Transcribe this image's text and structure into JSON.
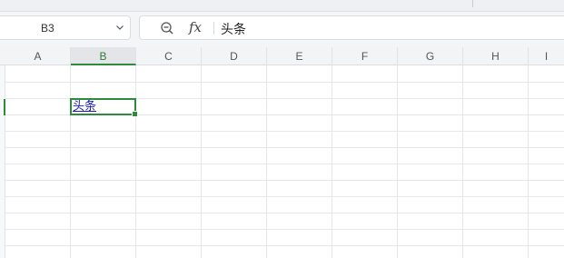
{
  "name_box": {
    "value": "B3"
  },
  "formula_bar": {
    "fx_label": "fx",
    "value": "头条"
  },
  "columns": [
    "A",
    "B",
    "C",
    "D",
    "E",
    "F",
    "G",
    "H",
    "I"
  ],
  "active_column": "B",
  "active_cell": {
    "ref": "B3",
    "text": "头条"
  },
  "colors": {
    "accent": "#2e8b3c",
    "link_text": "#1a1ab8"
  },
  "icons": {
    "namebox_dropdown": "chevron-down-icon",
    "zoom": "zoom-out-icon",
    "formula": "fx-icon"
  }
}
